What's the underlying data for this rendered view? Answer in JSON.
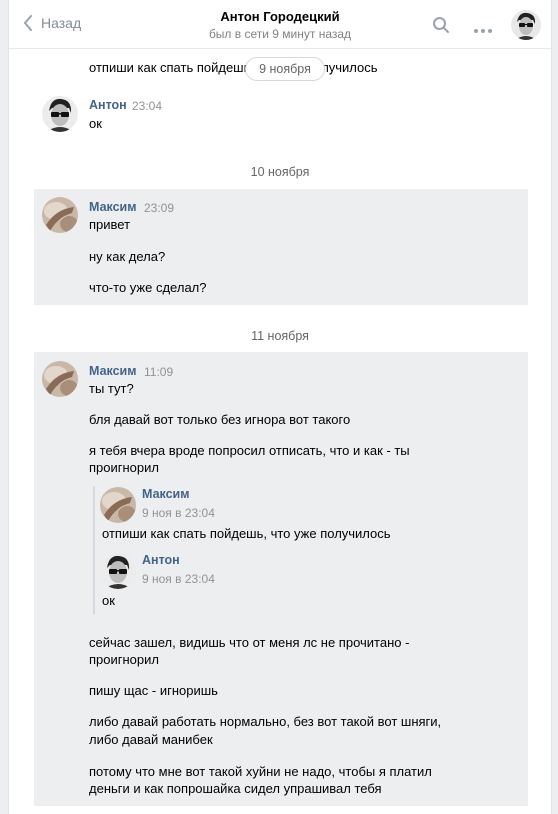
{
  "header": {
    "back_label": "Назад",
    "peer_name": "Антон Городецкий",
    "peer_status": "был в сети 9 минут назад"
  },
  "icons": {
    "back": "chevron-left-icon",
    "search": "search-icon",
    "more": "more-horizontal-icon"
  },
  "colors": {
    "link": "#42648b",
    "highlight": "#edeef0",
    "muted": "#828282"
  },
  "messages": {
    "m0_text": "отпиши как спать пойдешь, что уже получилось",
    "date_pill": "9 ноября",
    "anton_name": "Антон",
    "anton_time": "23:04",
    "anton_text": "ок",
    "date_nov10": "10 ноября",
    "maksim1_name": "Максим",
    "maksim1_time": "23:09",
    "maksim1_lines": [
      "привет",
      "ну как дела?",
      "что-то уже сделал?"
    ],
    "date_nov11": "11 ноября",
    "maksim2_name": "Максим",
    "maksim2_time": "11:09",
    "maksim2_lines_a": [
      "ты тут?",
      "бля давай вот только без игнора вот такого",
      "я тебя вчера вроде попросил отписать, что и как - ты",
      "проигнорил"
    ],
    "forwarded": [
      {
        "name": "Максим",
        "time": "9 ноя в 23:04",
        "text": "отпиши как спать пойдешь, что уже получилось"
      },
      {
        "name": "Антон",
        "time": "9 ноя в 23:04",
        "text": "ок"
      }
    ],
    "maksim2_lines_b": [
      "сейчас зашел, видишь что от меня лс не прочитано -",
      "проигнорил",
      "пишу щас - игноришь",
      "либо давай работать нормально, без вот такой вот шняги,",
      "либо давай манибек",
      "потому что мне вот такой хуйни не надо, чтобы я платил",
      "деньги и как попрошайка сидел упрашивал тебя"
    ]
  }
}
